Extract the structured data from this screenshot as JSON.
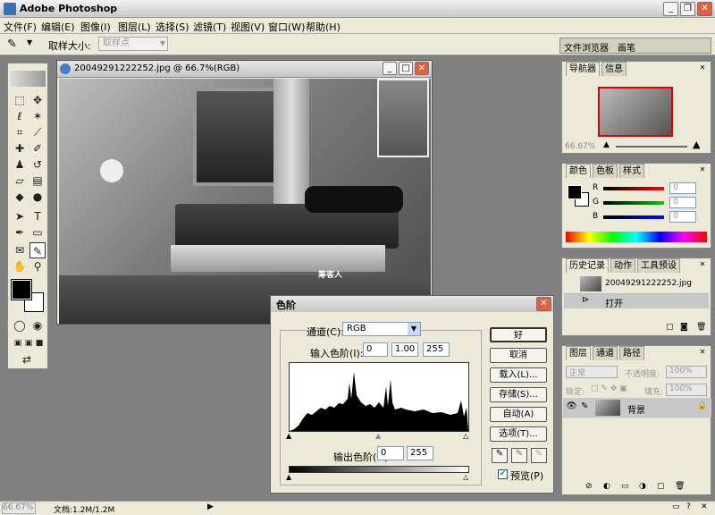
{
  "app": {
    "title": "Adobe Photoshop",
    "minimize": "_",
    "restore": "❐",
    "close": "✕"
  },
  "menu": [
    "文件(F)",
    "编辑(E)",
    "图像(I)",
    "图层(L)",
    "选择(S)",
    "滤镜(T)",
    "视图(V)",
    "窗口(W)",
    "帮助(H)"
  ],
  "options": {
    "sample_size_label": "取样大小:",
    "sample_size_value": "取样点"
  },
  "palette_well": {
    "file_browser": "文件浏览器",
    "brushes": "画笔"
  },
  "document": {
    "title": "20049291222252.jpg @ 66.7%(RGB)",
    "watermark": "筹客人"
  },
  "navigator": {
    "tab_nav": "导航器",
    "tab_info": "信息",
    "zoom": "66.67%"
  },
  "color_panel": {
    "tab_color": "颜色",
    "tab_swatches": "色板",
    "tab_styles": "样式",
    "r_label": "R",
    "g_label": "G",
    "b_label": "B",
    "r": "0",
    "g": "0",
    "b": "0"
  },
  "history": {
    "tab_history": "历史记录",
    "tab_actions": "动作",
    "tab_presets": "工具预设",
    "snapshot": "20049291222252.jpg",
    "step": "打开"
  },
  "layers": {
    "tab_layers": "图层",
    "tab_channels": "通道",
    "tab_paths": "路径",
    "blend_mode": "正常",
    "opacity_label": "不透明度:",
    "opacity": "100%",
    "lock_label": "锁定:",
    "fill_label": "填充:",
    "fill": "100%",
    "layer_name": "背景"
  },
  "levels": {
    "title": "色阶",
    "channel_label": "通道(C):",
    "channel_value": "RGB",
    "input_label": "输入色阶(I):",
    "input_black": "0",
    "input_gamma": "1.00",
    "input_white": "255",
    "output_label": "输出色阶(O):",
    "output_black": "0",
    "output_white": "255",
    "btn_ok": "好",
    "btn_cancel": "取消",
    "btn_load": "载入(L)...",
    "btn_save": "存储(S)...",
    "btn_auto": "自动(A)",
    "btn_options": "选项(T)...",
    "preview_label": "预览(P)",
    "preview_checked": true
  },
  "status": {
    "zoom": "66.67%",
    "doc_info": "文档:1.2M/1.2M"
  }
}
